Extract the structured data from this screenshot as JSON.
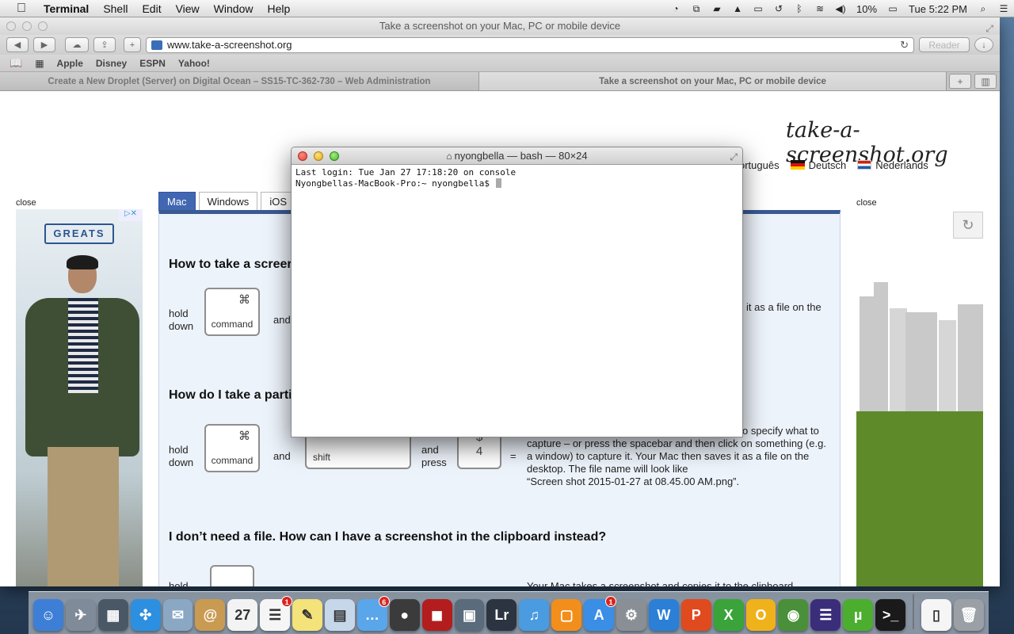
{
  "menubar": {
    "app_name": "Terminal",
    "menus": [
      "Shell",
      "Edit",
      "View",
      "Window",
      "Help"
    ],
    "battery": "10%",
    "clock": "Tue 5:22 PM",
    "status_icons": [
      "sync-icon",
      "crop-icon",
      "truck-icon",
      "drive-icon",
      "airplay-icon",
      "time-machine-icon",
      "bluetooth-icon",
      "wifi-icon",
      "volume-icon"
    ]
  },
  "browser": {
    "window_title": "Take a screenshot on your Mac, PC or mobile device",
    "url": "www.take-a-screenshot.org",
    "reader_label": "Reader",
    "bookmarks": [
      "Apple",
      "Disney",
      "ESPN",
      "Yahoo!"
    ],
    "tabs": [
      {
        "label": "Create a New Droplet (Server) on Digital Ocean – SS15-TC-362-730 – Web Administration",
        "active": false
      },
      {
        "label": "Take a screenshot on your Mac, PC or mobile device",
        "active": true
      }
    ]
  },
  "page": {
    "logo": "take-a-screenshot.org",
    "languages": [
      "ortuguês",
      "Deutsch",
      "Nederlands"
    ],
    "close_left": "close",
    "close_right": "close",
    "ad_brand": "GREATS",
    "os_tabs": [
      "Mac",
      "Windows",
      "iOS"
    ],
    "sections": [
      {
        "heading": "How to take a screer",
        "hold": "hold",
        "down": "down",
        "key1": "command",
        "key1_sym": "⌘",
        "and": "and",
        "result": "it as a file on the"
      },
      {
        "heading": "How do I take a parti",
        "hold": "hold",
        "down": "down",
        "key1": "command",
        "key1_sym": "⌘",
        "and": "and",
        "key2": "shift",
        "and_press_1": "and",
        "and_press_2": "press",
        "key3_sym": "$",
        "key3_num": "4",
        "equals": "=",
        "text_lines": [
          "o specify what to",
          "capture – or press the spacebar and then click on something (e.g.",
          "a window) to capture it. Your Mac then saves it as a file on the",
          "desktop. The file name will look like",
          "“Screen shot 2015-01-27 at 08.45.00 AM.png”."
        ]
      },
      {
        "heading": "I don’t need a file. How can I have a screenshot in the clipboard instead?",
        "hold": "hold",
        "result": "Your Mac takes a screenshot and copies it to the clipboard"
      }
    ]
  },
  "terminal": {
    "title": "nyongbella — bash — 80×24",
    "lines": [
      "Last login: Tue Jan 27 17:18:20 on console",
      "Nyongbellas-MacBook-Pro:~ nyongbella$ "
    ]
  },
  "dock": {
    "items": [
      {
        "name": "finder",
        "glyph": "☺",
        "color": "#3d7fd6"
      },
      {
        "name": "launchpad",
        "glyph": "✈",
        "color": "#7f8b99"
      },
      {
        "name": "mission-control",
        "glyph": "▦",
        "color": "#4a5866"
      },
      {
        "name": "safari",
        "glyph": "✣",
        "color": "#2d8fe0"
      },
      {
        "name": "mail-stamp",
        "glyph": "✉",
        "color": "#8aa7c4"
      },
      {
        "name": "contacts",
        "glyph": "@",
        "color": "#c99a52"
      },
      {
        "name": "calendar",
        "glyph": "27",
        "color": "#f3f3f3"
      },
      {
        "name": "reminders",
        "glyph": "☰",
        "color": "#f5f5f5",
        "badge": "1"
      },
      {
        "name": "notes",
        "glyph": "✎",
        "color": "#f4e27a"
      },
      {
        "name": "preview",
        "glyph": "▤",
        "color": "#c6d7ea"
      },
      {
        "name": "messages",
        "glyph": "…",
        "color": "#5aa6ea",
        "badge": "6"
      },
      {
        "name": "facetime",
        "glyph": "●",
        "color": "#3b3b3b"
      },
      {
        "name": "photo-booth",
        "glyph": "◼",
        "color": "#b31d1d"
      },
      {
        "name": "iphoto",
        "glyph": "▣",
        "color": "#5a6b7b"
      },
      {
        "name": "lightroom",
        "glyph": "Lr",
        "color": "#2b3440"
      },
      {
        "name": "itunes",
        "glyph": "♫",
        "color": "#4a9be0"
      },
      {
        "name": "ibooks",
        "glyph": "▢",
        "color": "#f28e1c"
      },
      {
        "name": "app-store",
        "glyph": "A",
        "color": "#3a8ee6",
        "badge": "1"
      },
      {
        "name": "system-preferences",
        "glyph": "⚙",
        "color": "#8a8f96"
      },
      {
        "name": "word",
        "glyph": "W",
        "color": "#2b7fd6"
      },
      {
        "name": "powerpoint",
        "glyph": "P",
        "color": "#e04a1f"
      },
      {
        "name": "excel",
        "glyph": "X",
        "color": "#3aa33a"
      },
      {
        "name": "outlook-o",
        "glyph": "O",
        "color": "#f0b21a"
      },
      {
        "name": "network-globe",
        "glyph": "◉",
        "color": "#4a8f3a"
      },
      {
        "name": "eclipse",
        "glyph": "☰",
        "color": "#3a2d7a"
      },
      {
        "name": "utorrent",
        "glyph": "µ",
        "color": "#4cae2f"
      },
      {
        "name": "terminal",
        "glyph": ">_",
        "color": "#1a1a1a"
      },
      {
        "name": "document",
        "glyph": "▯",
        "color": "#f5f5f5"
      },
      {
        "name": "trash",
        "glyph": "🗑",
        "color": "#9aa0a6"
      }
    ]
  }
}
